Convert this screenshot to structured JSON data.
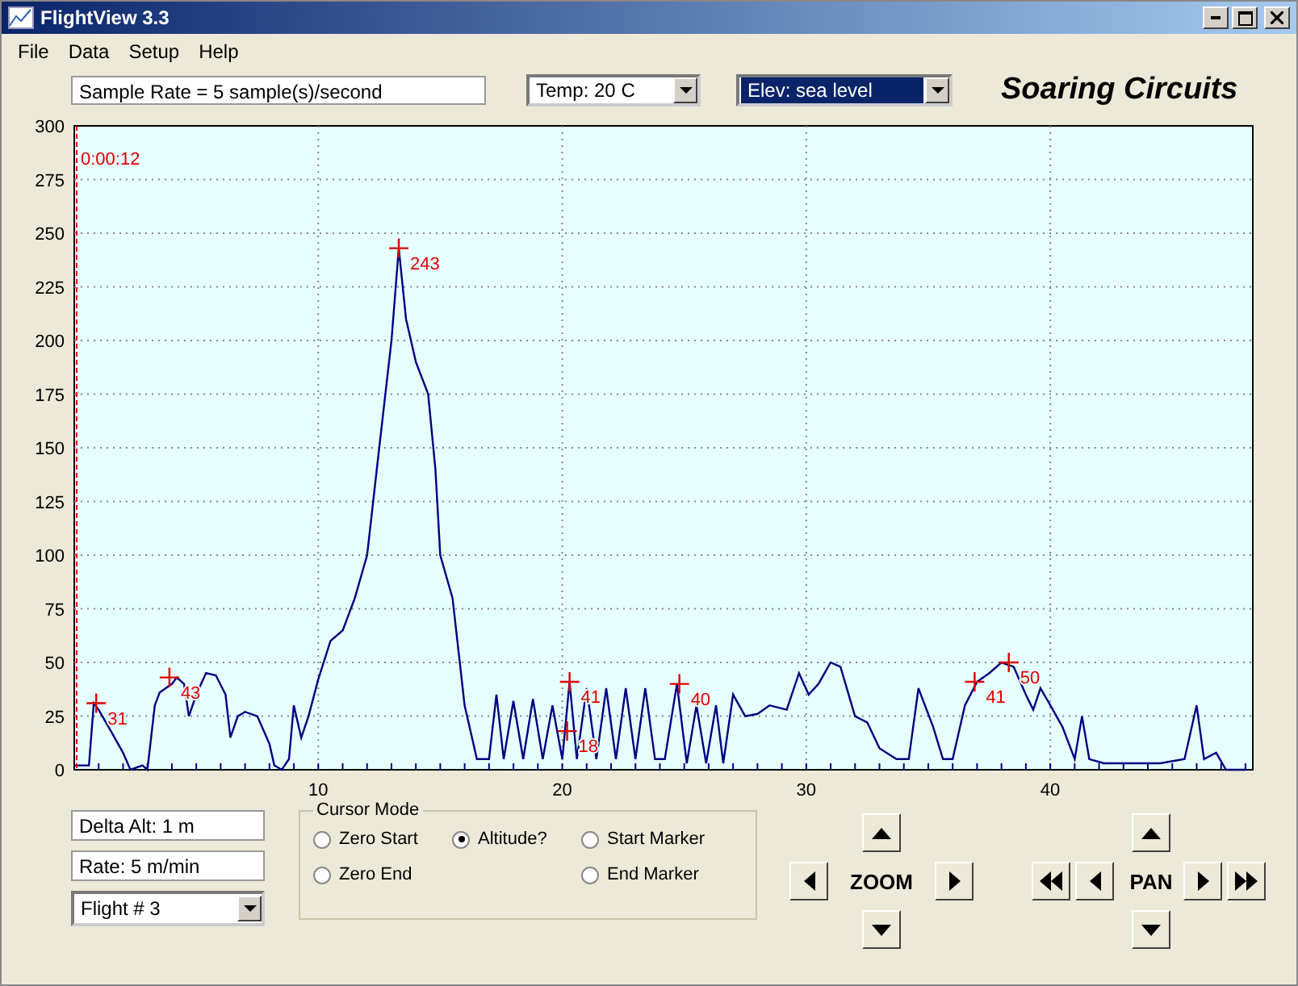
{
  "window": {
    "title": "FlightView 3.3"
  },
  "menu": [
    "File",
    "Data",
    "Setup",
    "Help"
  ],
  "toolbar": {
    "sample_rate": "Sample Rate =  5 sample(s)/second",
    "temp": "Temp:  20 C",
    "elevation": "Elev: sea level",
    "logo": "Soaring Circuits"
  },
  "cursor": {
    "time": "0:00:12"
  },
  "chart_data": {
    "type": "line",
    "grid": true,
    "xlim": [
      0,
      48.3
    ],
    "ylim": [
      0,
      300
    ],
    "xticks": [
      10,
      20,
      30,
      40
    ],
    "yticks": [
      0,
      25,
      50,
      75,
      100,
      125,
      150,
      175,
      200,
      225,
      250,
      275,
      300
    ],
    "x": [
      0,
      0.6,
      0.8,
      1,
      1.5,
      2,
      2.3,
      2.8,
      3,
      3.3,
      3.5,
      4,
      4.2,
      4.5,
      4.7,
      5,
      5.4,
      5.8,
      6.2,
      6.4,
      6.7,
      7,
      7.5,
      8,
      8.2,
      8.5,
      8.8,
      9,
      9.3,
      9.6,
      10,
      10.5,
      11,
      11.5,
      12,
      12.5,
      13,
      13.3,
      13.6,
      14,
      14.5,
      14.8,
      15,
      15.5,
      16,
      16.5,
      17,
      17.3,
      17.6,
      18,
      18.4,
      18.8,
      19.2,
      19.6,
      20,
      20.3,
      20.6,
      21,
      21.4,
      21.8,
      22.2,
      22.6,
      23,
      23.4,
      23.8,
      24.2,
      24.7,
      25.1,
      25.5,
      25.9,
      26.3,
      26.6,
      27,
      27.5,
      28,
      28.5,
      29.2,
      29.7,
      30.1,
      30.5,
      31,
      31.4,
      32,
      32.5,
      33,
      33.7,
      34.2,
      34.6,
      35.2,
      35.6,
      36,
      36.5,
      37,
      37.5,
      38,
      38.5,
      39,
      39.3,
      39.6,
      40,
      40.5,
      41,
      41.3,
      41.6,
      42.2,
      43,
      44.5,
      45.5,
      46,
      46.3,
      46.8,
      47.2,
      48
    ],
    "series": [
      {
        "color": "#000080",
        "values": [
          2,
          2,
          31,
          28,
          18,
          8,
          0,
          2,
          0,
          30,
          36,
          40,
          43,
          40,
          25,
          35,
          45,
          44,
          35,
          15,
          25,
          27,
          25,
          12,
          2,
          0,
          5,
          30,
          15,
          25,
          42,
          60,
          65,
          80,
          100,
          150,
          200,
          243,
          210,
          190,
          175,
          140,
          100,
          80,
          30,
          5,
          5,
          35,
          5,
          32,
          5,
          33,
          5,
          30,
          5,
          41,
          5,
          38,
          5,
          38,
          5,
          38,
          5,
          38,
          5,
          5,
          40,
          3,
          30,
          3,
          30,
          3,
          35,
          25,
          26,
          30,
          28,
          45,
          35,
          40,
          50,
          48,
          25,
          22,
          10,
          5,
          5,
          38,
          20,
          5,
          5,
          30,
          41,
          45,
          50,
          48,
          35,
          28,
          38,
          30,
          20,
          5,
          25,
          5,
          3,
          3,
          3,
          5,
          30,
          5,
          8,
          0,
          0
        ]
      }
    ],
    "annotations": [
      {
        "x": 13.3,
        "y": 243,
        "text": "243"
      },
      {
        "x": 0.9,
        "y": 31,
        "text": "31"
      },
      {
        "x": 3.9,
        "y": 43,
        "text": "43"
      },
      {
        "x": 20.3,
        "y": 41,
        "text": "41"
      },
      {
        "x": 20.2,
        "y": 18,
        "text": "18"
      },
      {
        "x": 24.8,
        "y": 40,
        "text": "40"
      },
      {
        "x": 36.9,
        "y": 41,
        "text": "41"
      },
      {
        "x": 38.3,
        "y": 50,
        "text": "50"
      }
    ]
  },
  "info": {
    "delta_alt": "Delta Alt: 1 m",
    "rate": "Rate: 5 m/min",
    "flight": "Flight # 3"
  },
  "cursor_mode": {
    "title": "Cursor Mode",
    "options": [
      {
        "label": "Zero Start",
        "selected": false
      },
      {
        "label": "Altitude?",
        "selected": true
      },
      {
        "label": "Start Marker",
        "selected": false
      },
      {
        "label": "Zero End",
        "selected": false
      },
      {
        "label": "End Marker",
        "selected": false
      }
    ]
  },
  "zoom": {
    "label": "ZOOM"
  },
  "pan": {
    "label": "PAN"
  }
}
